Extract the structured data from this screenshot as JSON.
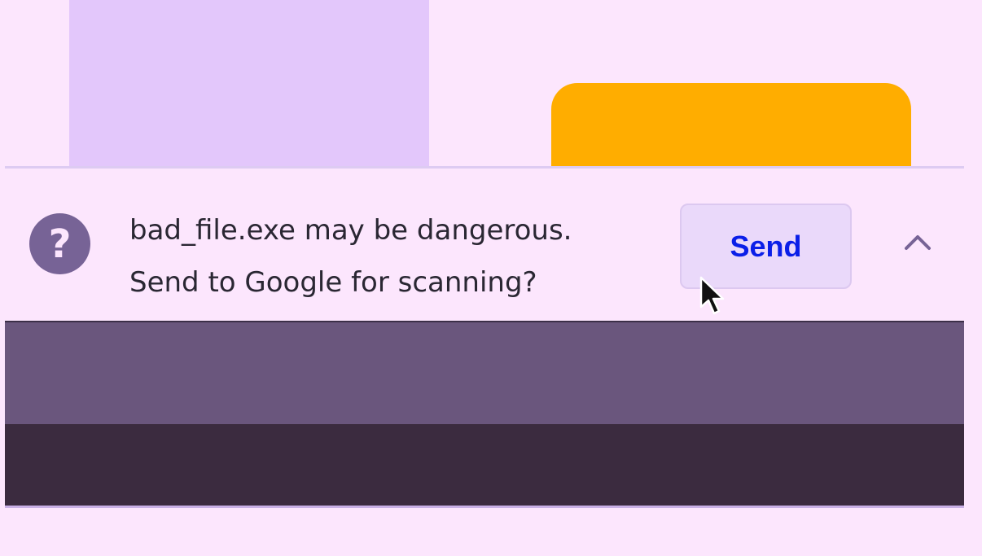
{
  "download_warning": {
    "message_line1": "bad_file.exe may be dangerous.",
    "message_line2": "Send to Google for scanning?",
    "send_button_label": "Send",
    "icons": {
      "warning": "question-mark-icon",
      "expand": "chevron-up-icon",
      "pointer": "cursor-icon"
    }
  },
  "colors": {
    "page_background": "#fce6fd",
    "warning_icon": "#776396",
    "send_button_text": "#0b1fe8",
    "send_button_background": "#ead9fa",
    "orange_card": "#ffad00",
    "lavender_panel": "#e3c7fb",
    "purple_bar": "#6a567d",
    "dark_strip": "#3b2b3f"
  }
}
